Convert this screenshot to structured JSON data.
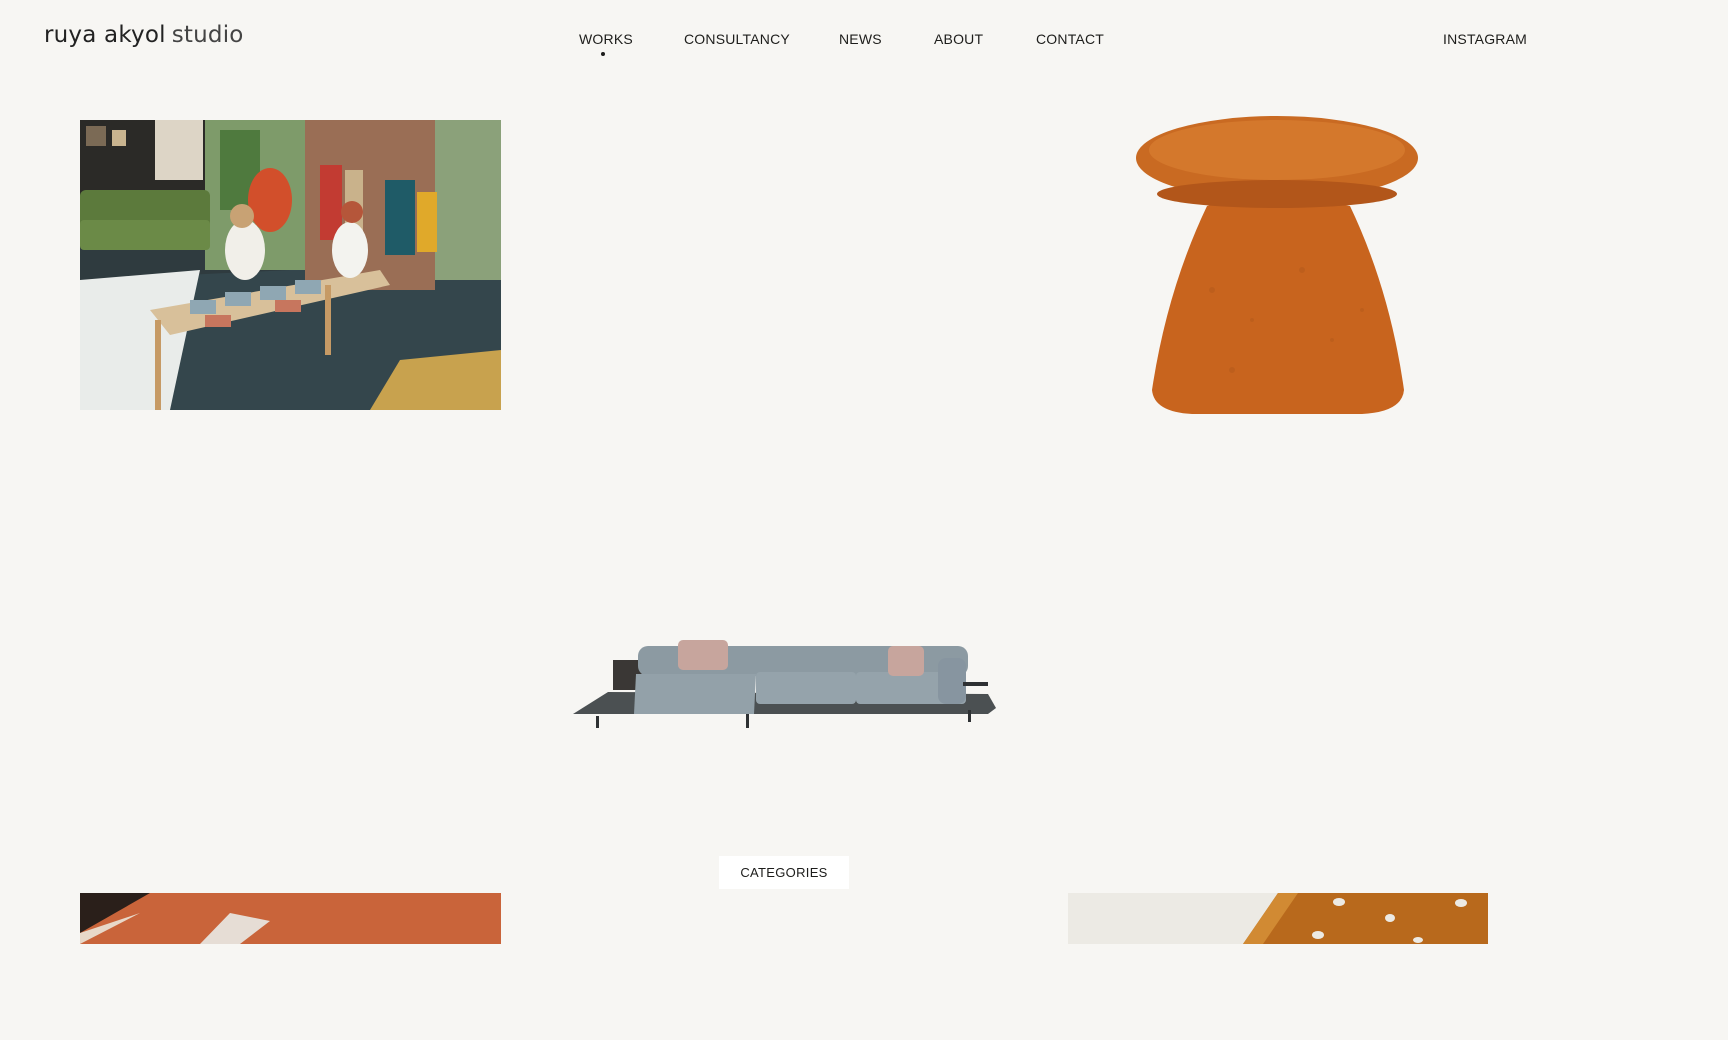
{
  "brand": {
    "name_main": "ruya akyol",
    "name_sub": "studio"
  },
  "nav": {
    "items": [
      {
        "label": "WORKS",
        "active": true
      },
      {
        "label": "CONSULTANCY"
      },
      {
        "label": "NEWS"
      },
      {
        "label": "ABOUT"
      },
      {
        "label": "CONTACT"
      }
    ],
    "social": "INSTAGRAM"
  },
  "works": [
    {
      "image": "showroom-photo"
    },
    {
      "image": "orange-boucle-pouf"
    },
    {
      "image": "grey-modular-sofa"
    },
    {
      "image": "orange-paper-detail"
    },
    {
      "image": "amber-perforated-detail"
    }
  ],
  "filters": {
    "button_label": "CATEGORIES"
  },
  "colors": {
    "background": "#f7f6f3",
    "text": "#1d1d1b",
    "button_bg": "#ffffff"
  }
}
